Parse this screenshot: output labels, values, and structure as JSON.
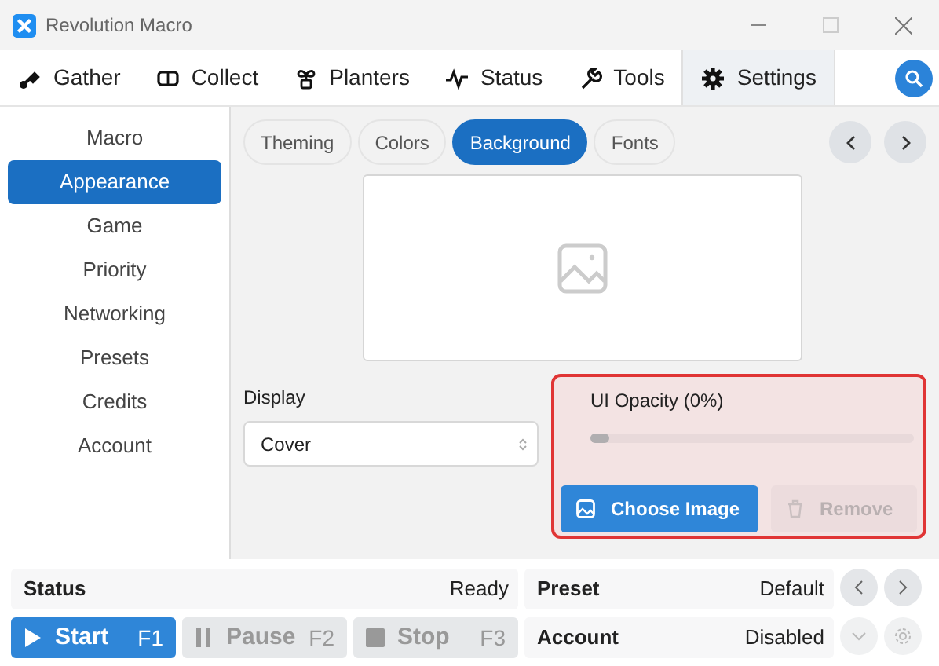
{
  "window": {
    "title": "Revolution Macro"
  },
  "tabs": [
    {
      "label": "Gather",
      "selected": false
    },
    {
      "label": "Collect",
      "selected": false
    },
    {
      "label": "Planters",
      "selected": false
    },
    {
      "label": "Status",
      "selected": false
    },
    {
      "label": "Tools",
      "selected": false
    },
    {
      "label": "Settings",
      "selected": true
    }
  ],
  "sidebar": {
    "items": [
      {
        "label": "Macro",
        "selected": false
      },
      {
        "label": "Appearance",
        "selected": true
      },
      {
        "label": "Game",
        "selected": false
      },
      {
        "label": "Priority",
        "selected": false
      },
      {
        "label": "Networking",
        "selected": false
      },
      {
        "label": "Presets",
        "selected": false
      },
      {
        "label": "Credits",
        "selected": false
      },
      {
        "label": "Account",
        "selected": false
      }
    ]
  },
  "subtabs": [
    {
      "label": "Theming",
      "selected": false
    },
    {
      "label": "Colors",
      "selected": false
    },
    {
      "label": "Background",
      "selected": true
    },
    {
      "label": "Fonts",
      "selected": false
    }
  ],
  "display": {
    "label": "Display",
    "value": "Cover"
  },
  "opacity": {
    "label": "UI Opacity (0%)",
    "level": 0
  },
  "image_buttons": [
    {
      "label": "Choose Image",
      "disabled": false
    },
    {
      "label": "Remove",
      "disabled": true
    }
  ],
  "status": {
    "label": "Status",
    "value": "Ready"
  },
  "controls": [
    {
      "label": "Start",
      "key": "F1",
      "disabled": false
    },
    {
      "label": "Pause",
      "key": "F2",
      "disabled": true
    },
    {
      "label": "Stop",
      "key": "F3",
      "disabled": true
    }
  ],
  "preset": {
    "label": "Preset",
    "value": "Default"
  },
  "account": {
    "label": "Account",
    "value": "Disabled",
    "disabled": true
  }
}
